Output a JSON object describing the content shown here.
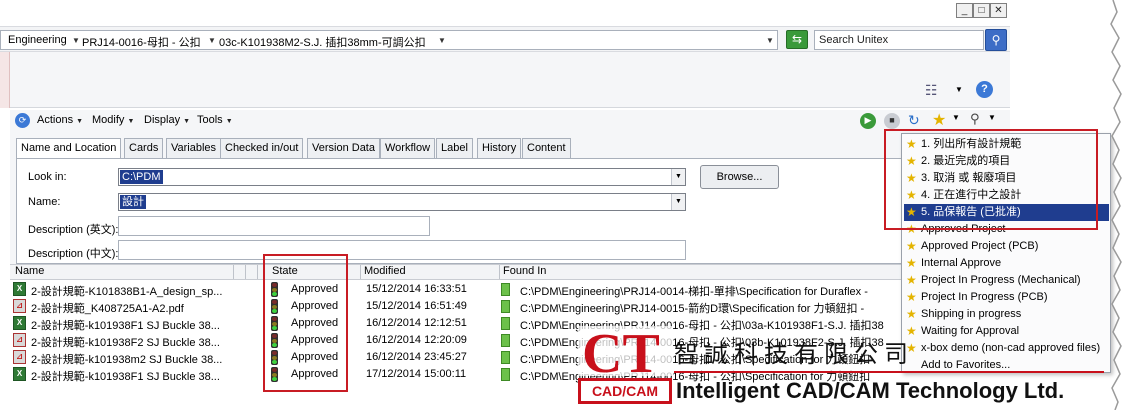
{
  "address": {
    "crumbs": [
      "Engineering",
      "PRJ14-0016-母扣 - 公扣",
      "03c-K101938M2-S.J. 插扣38mm-可調公扣"
    ],
    "search_placeholder": "Search Unitex"
  },
  "command_bar": {
    "actions": "Actions",
    "modify": "Modify",
    "display": "Display",
    "tools": "Tools"
  },
  "tabs": [
    "Name and Location",
    "Cards",
    "Variables",
    "Checked in/out",
    "Version Data",
    "Workflow",
    "Label",
    "History",
    "Content"
  ],
  "form": {
    "look_in_label": "Look in:",
    "look_in_value": "C:\\PDM",
    "name_label": "Name:",
    "name_value": "設計",
    "desc_en_label": "Description (英文):",
    "desc_cn_label": "Description (中文):",
    "browse_label": "Browse..."
  },
  "columns": {
    "name": "Name",
    "state": "State",
    "modified": "Modified",
    "found_in": "Found In"
  },
  "rows": [
    {
      "type": "excel",
      "name": "2-設計規範-K101838B1-A_design_sp...",
      "state": "Approved",
      "modified": "15/12/2014 16:33:51",
      "found_in": "C:\\PDM\\Engineering\\PRJ14-0014-梯扣-單排\\Specification for Duraflex -"
    },
    {
      "type": "pdf",
      "name": "2-設計規範_K408725A1-A2.pdf",
      "state": "Approved",
      "modified": "15/12/2014 16:51:49",
      "found_in": "C:\\PDM\\Engineering\\PRJ14-0015-箭約D環\\Specification for 力頓鈕扣 -"
    },
    {
      "type": "excel",
      "name": "2-設計規範-k101938F1 SJ Buckle 38...",
      "state": "Approved",
      "modified": "16/12/2014 12:12:51",
      "found_in": "C:\\PDM\\Engineering\\PRJ14-0016-母扣 - 公扣\\03a-K101938F1-S.J. 插扣38"
    },
    {
      "type": "pdf",
      "name": "2-設計規範-k101938F2 SJ Buckle 38...",
      "state": "Approved",
      "modified": "16/12/2014 12:20:09",
      "found_in": "C:\\PDM\\Engineering\\PRJ14-0016-母扣 - 公扣\\03b-K101938F2-S.J. 插扣38"
    },
    {
      "type": "pdf",
      "name": "2-設計規範-k101938m2 SJ Buckle 38...",
      "state": "Approved",
      "modified": "16/12/2014 23:45:27",
      "found_in": "C:\\PDM\\Engineering\\PRJ14-0016-母扣 - 公扣\\Specification for 力頓鈕扣"
    },
    {
      "type": "excel",
      "name": "2-設計規範-k101938F1 SJ Buckle 38...",
      "state": "Approved",
      "modified": "17/12/2014 15:00:11",
      "found_in": "C:\\PDM\\Engineering\\PRJ14-0016-母扣 - 公扣\\Specification for 力頓鈕扣"
    }
  ],
  "menu": {
    "items": [
      "1. 列出所有設計規範",
      "2. 最近完成的項目",
      "3. 取消 或 報廢項目",
      "4. 正在進行中之設計",
      "5. 品保報告 (已批准)",
      "Approved Project",
      "Approved Project (PCB)",
      "Internal Approve",
      "Project In Progress (Mechanical)",
      "Project In Progress (PCB)",
      "Shipping in progress",
      "Waiting for Approval",
      "x-box demo (non-cad  approved files)",
      "Add to Favorites..."
    ],
    "selected_index": 4
  },
  "watermark": {
    "logo_letters": "CT",
    "logo_tag": "CAD/CAM",
    "company_cn": "智誠科技有限公司",
    "company_en": "Intelligent CAD/CAM Technology Ltd."
  },
  "colors": {
    "highlight": "#c81c24",
    "selection": "#1f3d8f",
    "panel_bg": "#f5f6f8"
  }
}
